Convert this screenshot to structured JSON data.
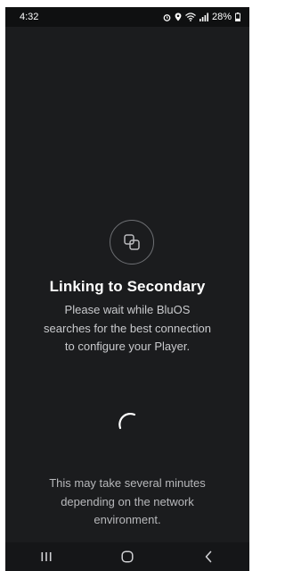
{
  "status_bar": {
    "time": "4:32",
    "battery": "28%",
    "icons": [
      "alarm-icon",
      "location-icon",
      "wifi-icon",
      "signal-icon",
      "battery-icon"
    ]
  },
  "main": {
    "icon": "link-squares-icon",
    "title": "Linking to Secondary",
    "message": "Please wait while BluOS searches for the best connection to configure your Player.",
    "footer": "This may take several minutes depending on the network environment."
  },
  "nav_bar": {
    "icons": [
      "recent-apps-icon",
      "home-icon",
      "back-icon"
    ]
  },
  "colors": {
    "background": "#1b1c1e",
    "status_bar": "#0f1011",
    "text_primary": "#ffffff",
    "text_secondary": "#c9cacd"
  }
}
